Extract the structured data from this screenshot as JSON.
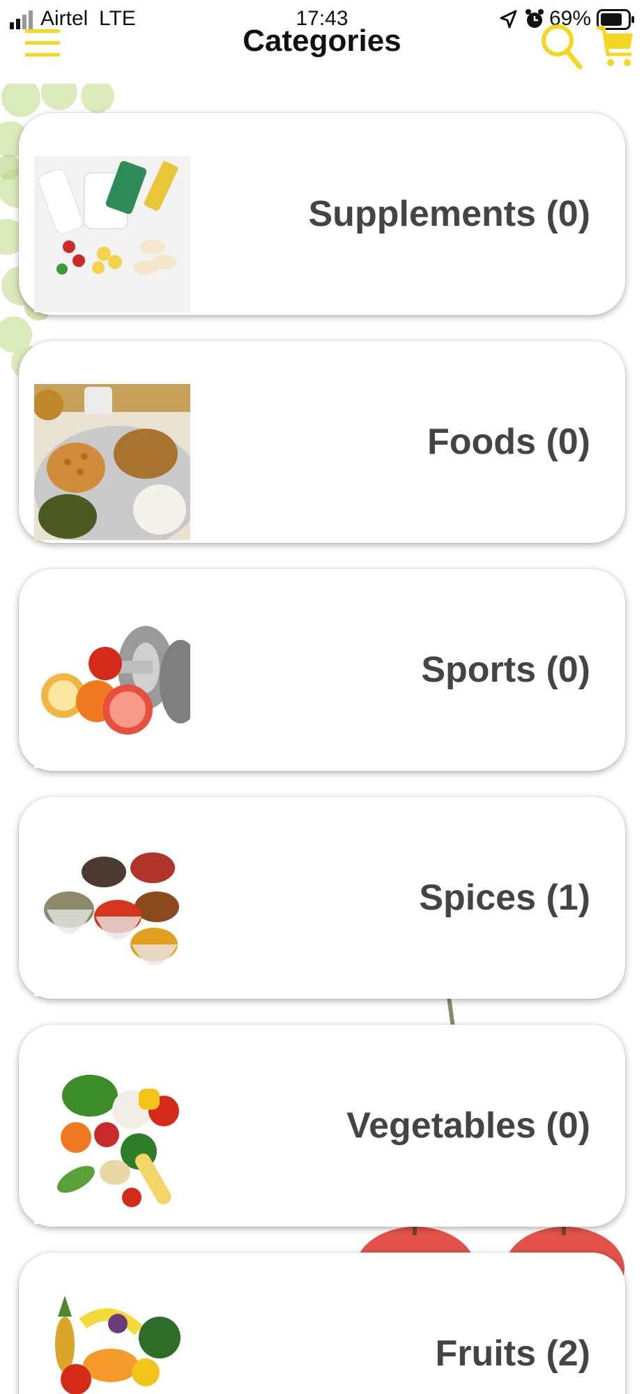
{
  "status_bar": {
    "carrier": "Airtel",
    "network": "LTE",
    "time": "17:43",
    "battery_percent": "69%",
    "icons": [
      "signal-icon",
      "location-arrow-icon",
      "alarm-icon",
      "battery-icon"
    ]
  },
  "header": {
    "title": "Categories",
    "menu_icon": "hamburger-menu-icon",
    "search_icon": "search-icon",
    "cart_icon": "cart-icon"
  },
  "colors": {
    "accent": "#F5D623",
    "label_text": "#444444",
    "card_background": "#FFFFFF"
  },
  "categories": [
    {
      "label": "Supplements (0)",
      "image": "supplements-image"
    },
    {
      "label": "Foods (0)",
      "image": "foods-image"
    },
    {
      "label": "Sports (0)",
      "image": "sports-image"
    },
    {
      "label": "Spices (1)",
      "image": "spices-image"
    },
    {
      "label": "Vegetables (0)",
      "image": "vegetables-image"
    },
    {
      "label": "Fruits (2)",
      "image": "fruits-image"
    }
  ]
}
